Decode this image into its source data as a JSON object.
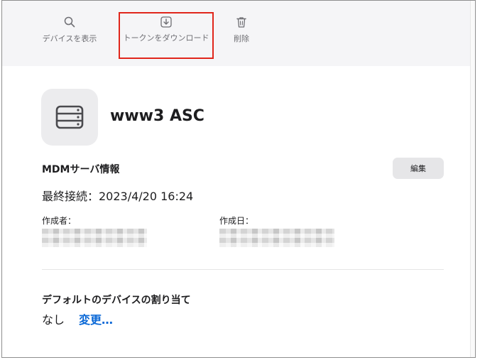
{
  "toolbar": {
    "view_devices_label": "デバイスを表示",
    "download_token_label": "トークンをダウンロード",
    "delete_label": "削除",
    "highlight_color": "#e0261b"
  },
  "server": {
    "name": "www3 ASC",
    "icon": "server-icon"
  },
  "mdm_info": {
    "title": "MDMサーバ情報",
    "edit_label": "編集",
    "last_contact": "最終接続：2023/4/20 16:24",
    "creator_label": "作成者：",
    "created_date_label": "作成日："
  },
  "assignment": {
    "title": "デフォルトのデバイスの割り当て",
    "value": "なし",
    "change_label": "変更…",
    "link_color": "#0a68d6"
  }
}
